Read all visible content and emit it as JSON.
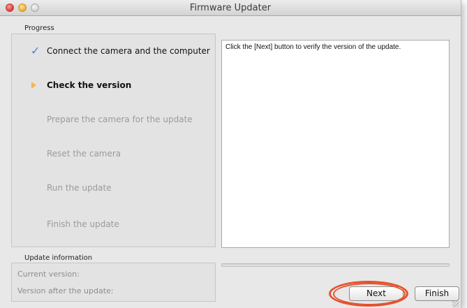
{
  "window": {
    "title": "Firmware Updater"
  },
  "progress": {
    "section_label": "Progress",
    "steps": [
      {
        "label": "Connect the camera and the computer",
        "state": "done",
        "icon": "check-icon"
      },
      {
        "label": "Check the version",
        "state": "active",
        "icon": "arrow-icon"
      },
      {
        "label": "Prepare the camera for the update",
        "state": "pending",
        "icon": ""
      },
      {
        "label": "Reset the camera",
        "state": "pending",
        "icon": ""
      },
      {
        "label": "Run the update",
        "state": "pending",
        "icon": ""
      },
      {
        "label": "Finish the update",
        "state": "pending",
        "icon": ""
      }
    ]
  },
  "message": {
    "text": "Click the [Next] button to verify the version of the update."
  },
  "update_info": {
    "section_label": "Update information",
    "current_version_label": "Current version:",
    "version_after_label": "Version after the update:"
  },
  "buttons": {
    "next_label": "Next",
    "finish_label": "Finish"
  },
  "colors": {
    "check": "#3c86d8",
    "active_arrow": "#f3b64d",
    "highlight_ring": "#e3532f"
  }
}
